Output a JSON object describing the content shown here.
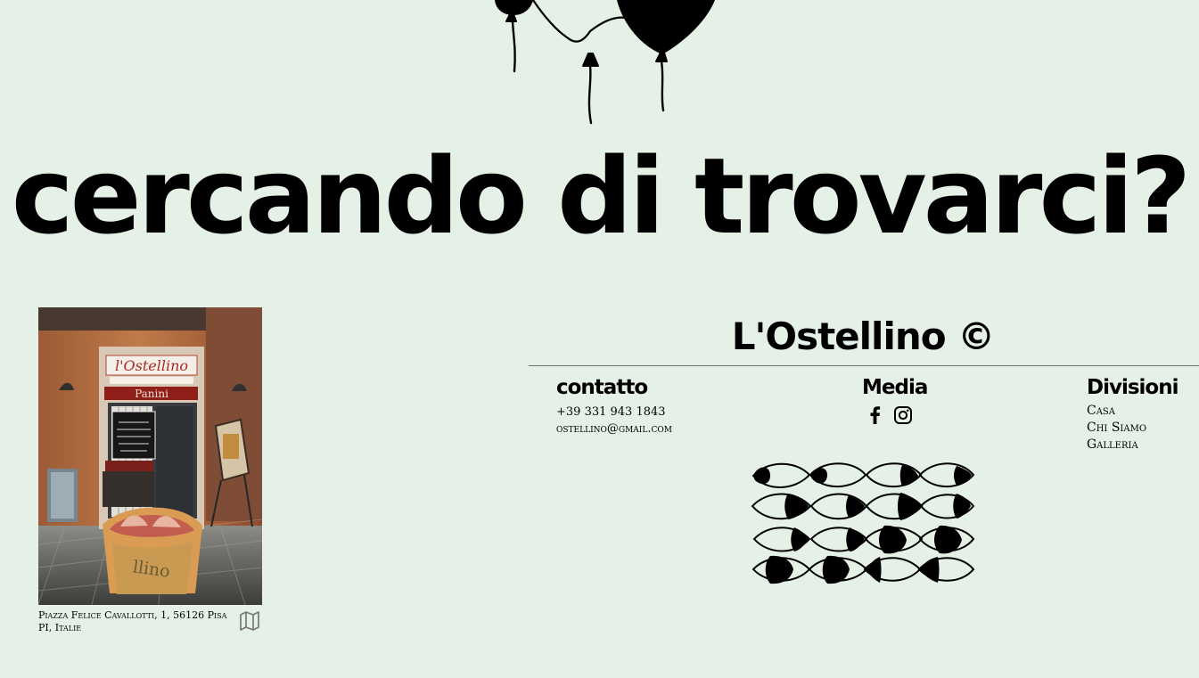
{
  "headline": "cercando di trovarci?",
  "photo": {
    "alt": "L'Ostellino storefront with sandwich",
    "sign_text": "l'Ostellino",
    "banner_text": "Panini"
  },
  "address": "Piazza Felice Cavallotti, 1, 56126 Pisa PI, Italie",
  "icons": {
    "map": "map-icon",
    "facebook": "facebook-icon",
    "instagram": "instagram-icon",
    "balloons": "balloons-illustration",
    "eyes": "eyes-pattern-illustration"
  },
  "brand": "L'Ostellino ©",
  "contact": {
    "title": "contatto",
    "phone": "+39 331 943 1843",
    "email": "ostellino@gmail.com"
  },
  "media": {
    "title": "Media"
  },
  "divisions": {
    "title": "Divisioni",
    "items": [
      "Casa",
      "Chi Siamo",
      "Galleria"
    ]
  },
  "colors": {
    "background": "#e5f0e7",
    "text": "#000000",
    "rule": "#6f7671",
    "icon_grey": "#777777"
  }
}
